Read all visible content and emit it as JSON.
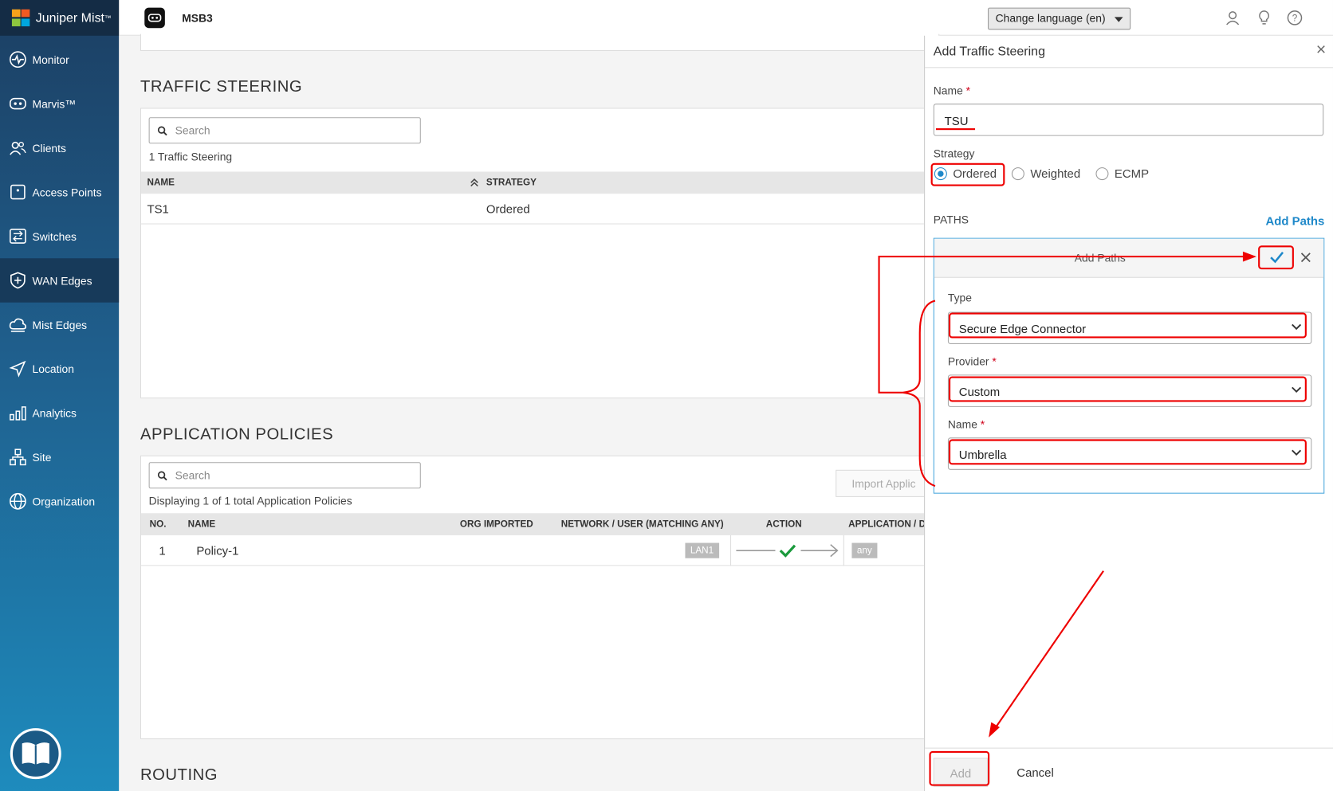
{
  "brand": {
    "logo_text": "Juniper Mist",
    "trademark": "™"
  },
  "nav": [
    {
      "label": "Monitor",
      "icon": "monitor-icon"
    },
    {
      "label": "Marvis™",
      "icon": "marvis-icon"
    },
    {
      "label": "Clients",
      "icon": "clients-icon"
    },
    {
      "label": "Access Points",
      "icon": "access-point-icon"
    },
    {
      "label": "Switches",
      "icon": "switch-icon"
    },
    {
      "label": "WAN Edges",
      "icon": "wan-edge-icon",
      "active": true
    },
    {
      "label": "Mist Edges",
      "icon": "cloud-icon"
    },
    {
      "label": "Location",
      "icon": "location-icon"
    },
    {
      "label": "Analytics",
      "icon": "analytics-icon"
    },
    {
      "label": "Site",
      "icon": "site-icon"
    },
    {
      "label": "Organization",
      "icon": "globe-icon"
    }
  ],
  "header": {
    "site_name": "MSB3",
    "language": "Change language (en)"
  },
  "traffic_steering": {
    "title": "TRAFFIC STEERING",
    "search_placeholder": "Search",
    "count": "1 Traffic Steering",
    "columns": {
      "name": "NAME",
      "strategy": "STRATEGY"
    },
    "rows": [
      {
        "name": "TS1",
        "strategy": "Ordered"
      }
    ]
  },
  "app_policies": {
    "title": "APPLICATION POLICIES",
    "search_placeholder": "Search",
    "count": "Displaying 1 of 1 total Application Policies",
    "import_label": "Import Applic",
    "columns": {
      "no": "NO.",
      "name": "NAME",
      "org": "ORG IMPORTED",
      "network": "NETWORK / USER (MATCHING ANY)",
      "action": "ACTION",
      "app": "APPLICATION / D"
    },
    "rows": [
      {
        "no": "1",
        "name": "Policy-1",
        "network": "LAN1",
        "app": "any"
      }
    ]
  },
  "routing": {
    "title": "ROUTING"
  },
  "drawer": {
    "title": "Add Traffic Steering",
    "name_label": "Name",
    "name_value": "TSU",
    "strategy_label": "Strategy",
    "strategies": [
      "Ordered",
      "Weighted",
      "ECMP"
    ],
    "selected_strategy": "Ordered",
    "paths_label": "PATHS",
    "add_paths_link": "Add Paths",
    "paths_form": {
      "title": "Add Paths",
      "type_label": "Type",
      "type_value": "Secure Edge Connector",
      "provider_label": "Provider",
      "provider_value": "Custom",
      "name_label": "Name",
      "name_value": "Umbrella"
    },
    "add_button": "Add",
    "cancel_button": "Cancel"
  },
  "colors": {
    "accent": "#1e88c9",
    "annotation": "#e00000",
    "sidebar_top": "#1c3f63",
    "sidebar_bottom": "#1e8bbd",
    "success": "#1a9a3c"
  }
}
